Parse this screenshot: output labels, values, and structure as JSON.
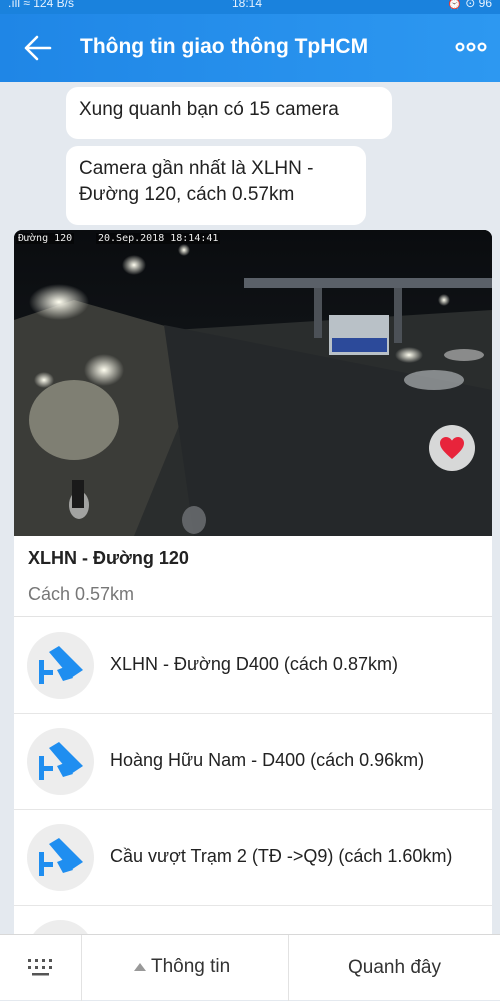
{
  "status_bar": {
    "left": ".ıll ≈ 124 B/s",
    "time": "18:14",
    "right": "⏰ ⊙ 96"
  },
  "header": {
    "title": "Thông tin giao thông TpHCM",
    "back_icon": "arrow-left-icon",
    "menu_icon": "more-dots-icon"
  },
  "messages": [
    "Xung quanh bạn có 15 camera",
    "Camera gần nhất là XLHN -\nĐường 120, cách 0.57km"
  ],
  "camera": {
    "image_label": "Đường 120",
    "image_timestamp": "20.Sep.2018  18:14:41",
    "name": "XLHN - Đường 120",
    "distance": "Cách 0.57km",
    "favorite_icon": "heart-icon"
  },
  "nearby_cameras": [
    "XLHN - Đường D400 (cách 0.87km)",
    "Hoàng Hữu Nam - D400 (cách 0.96km)",
    "Cầu vượt Trạm 2 (TĐ ->Q9) (cách 1.60km)"
  ],
  "bottom_bar": {
    "keyboard_icon": "keyboard-icon",
    "info_label": "Thông tin",
    "nearby_label": "Quanh đây"
  },
  "colors": {
    "header": "#1f86e6",
    "camera_icon": "#1f8ef0",
    "heart": "#e8243b"
  }
}
